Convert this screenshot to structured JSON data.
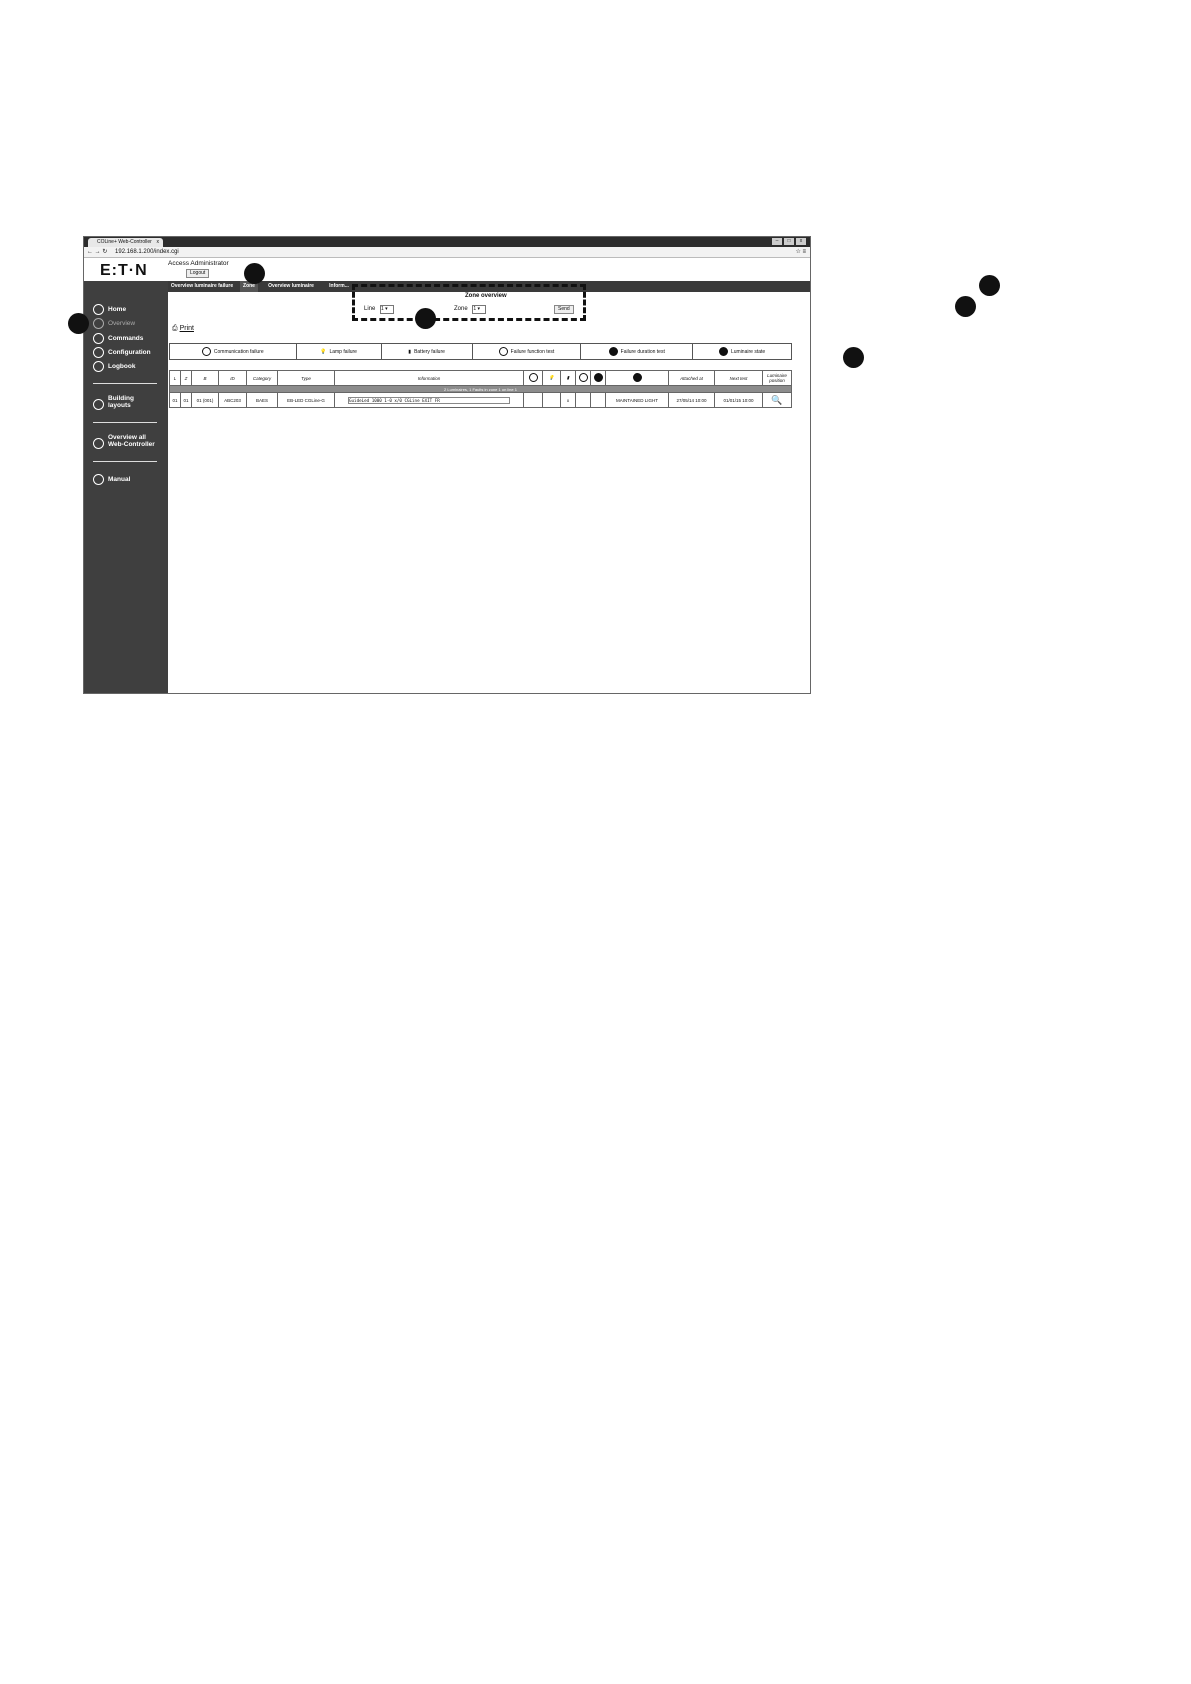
{
  "browser": {
    "tab_title": "COLine+ Web-Controller",
    "tab_close": "x",
    "address": "192.168.1.200/index.cgi",
    "window_buttons": [
      "–",
      "□",
      "x"
    ]
  },
  "header": {
    "brand": "E:T·N",
    "access_label": "Access Administrator",
    "logout_label": "Logout"
  },
  "top_tabs": [
    "Overview luminaire failure",
    "Zone",
    "Overview luminaire",
    "Inform..."
  ],
  "sidebar": {
    "items": [
      {
        "label": "Home",
        "icon": "home-icon",
        "active": false
      },
      {
        "label": "Overview",
        "icon": "overview-icon",
        "active": true
      },
      {
        "label": "Commands",
        "icon": "commands-icon",
        "active": false
      },
      {
        "label": "Configuration",
        "icon": "configuration-icon",
        "active": false
      },
      {
        "label": "Logbook",
        "icon": "logbook-icon",
        "active": false
      }
    ],
    "building_layouts": [
      "Building",
      "layouts"
    ],
    "overview_all": [
      "Overview all",
      "Web-Controller"
    ],
    "manual": "Manual"
  },
  "zone_overview": {
    "title": "Zone overview",
    "line_label": "Line",
    "line_value": "1",
    "zone_label": "Zone",
    "zone_value": "1",
    "send_label": "Send"
  },
  "print_label": "Print",
  "legend": [
    {
      "label": "Communication failure",
      "icon": "no-entry-icon"
    },
    {
      "label": "Lamp failure",
      "icon": "lamp-icon"
    },
    {
      "label": "Battery failure",
      "icon": "battery-icon"
    },
    {
      "label": "Failure function test",
      "icon": "power-icon"
    },
    {
      "label": "Failure duration test",
      "icon": "power-filled-icon"
    },
    {
      "label": "Luminaire state",
      "icon": "info-icon"
    }
  ],
  "table": {
    "headers": [
      "L",
      "Z",
      "B",
      "ID",
      "Category",
      "Type",
      "Information",
      "",
      "",
      "",
      "",
      "",
      "",
      "Attached at",
      "Next test",
      "Luminaire position"
    ],
    "summary": "2 Luminaires, 1 Faults in zone 1 on line 1",
    "rows": [
      [
        "01",
        "01",
        "01 (001)",
        "ABC203",
        "BAES",
        "EB-LED CGLine-G",
        "GuideLed 1000 1-0 x/0 CGLine EXIT FR",
        "",
        "",
        "x",
        "",
        "",
        "MAINTAINED LIGHT",
        "27/05/14 10:00",
        "01/01/15 10:00",
        ""
      ]
    ]
  }
}
